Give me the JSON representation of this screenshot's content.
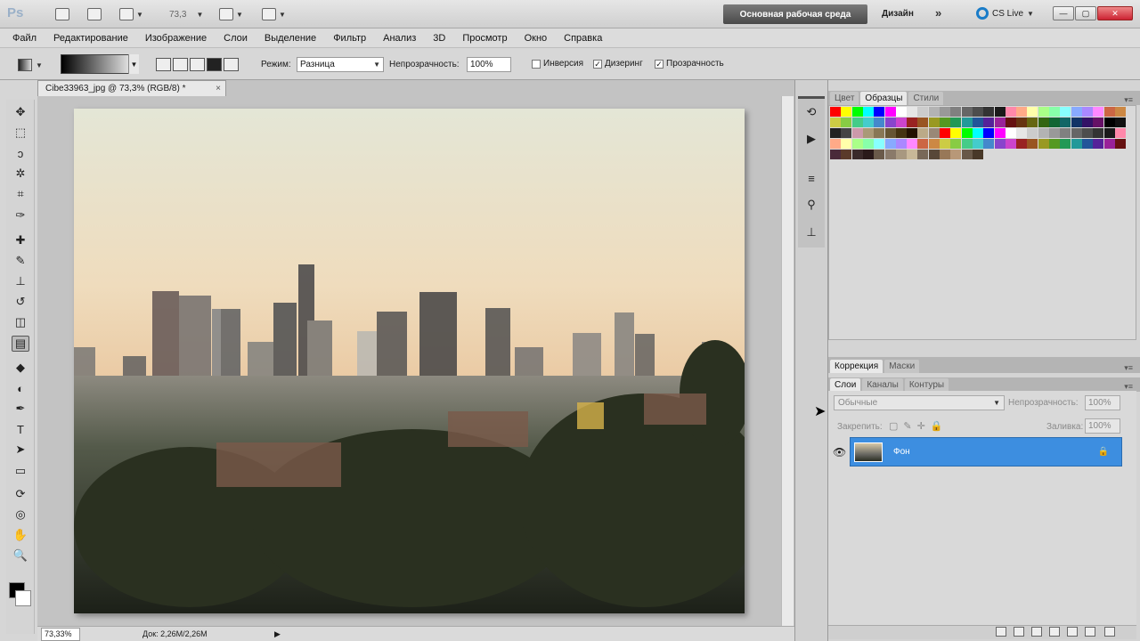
{
  "app": {
    "logo": "Ps",
    "zoom": "73,3",
    "workspace_active": "Основная рабочая среда",
    "workspace_design": "Дизайн",
    "workspace_more": "»",
    "cslive": "CS Live",
    "win_min": "—",
    "win_max": "▢",
    "win_close": "✕"
  },
  "menu": [
    "Файл",
    "Редактирование",
    "Изображение",
    "Слои",
    "Выделение",
    "Фильтр",
    "Анализ",
    "3D",
    "Просмотр",
    "Окно",
    "Справка"
  ],
  "options": {
    "mode_label": "Режим:",
    "mode_value": "Разница",
    "opacity_label": "Непрозрачность:",
    "opacity_value": "100%",
    "inverse": "Инверсия",
    "dither": "Дизеринг",
    "transparency": "Прозрачность",
    "inverse_checked": "",
    "dither_checked": "✓",
    "transparency_checked": "✓"
  },
  "document": {
    "tab_title": "Cibe33963_jpg @ 73,3% (RGB/8) *",
    "close": "×",
    "status_zoom": "73,33%",
    "status_doc": "Док: 2,26M/2,26M",
    "status_arrow": "▶"
  },
  "panels": {
    "top_tabs": [
      "Цвет",
      "Образцы",
      "Стили"
    ],
    "mid_tabs": [
      "Коррекция",
      "Маски"
    ],
    "layers_tabs": [
      "Слои",
      "Каналы",
      "Контуры"
    ],
    "blend_mode": "Обычные",
    "opacity_label": "Непрозрачность:",
    "opacity_value": "100%",
    "lock_label": "Закрепить:",
    "fill_label": "Заливка:",
    "fill_value": "100%",
    "layer_name": "Фон",
    "layer_lock_icon": "🔒",
    "menu_icon": "▾≡"
  },
  "colors": {
    "layer_selected": "#3d8ee0",
    "workspace_button": "#5a5a5a"
  },
  "icons": [
    "move-icon",
    "marquee-icon",
    "lasso-icon",
    "quick-select-icon",
    "crop-icon",
    "eyedropper-icon",
    "healing-icon",
    "brush-icon",
    "stamp-icon",
    "history-brush-icon",
    "eraser-icon",
    "gradient-icon",
    "blur-icon",
    "dodge-icon",
    "pen-icon",
    "type-icon",
    "path-select-icon",
    "shape-icon",
    "3d-rotate-icon",
    "3d-orbit-icon",
    "hand-icon",
    "zoom-icon"
  ]
}
